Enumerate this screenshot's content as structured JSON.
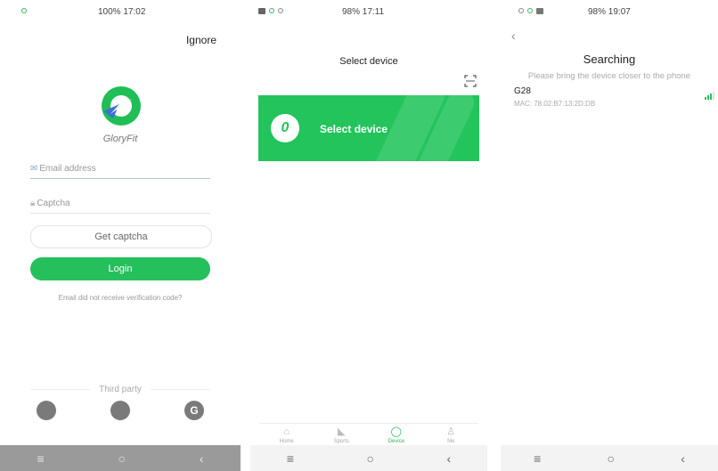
{
  "login_screen": {
    "status": {
      "time_text": "100% 17:02"
    },
    "ignore_label": "Ignore",
    "brand_name": "GloryFit",
    "email_placeholder": "Email address",
    "captcha_placeholder": "Captcha",
    "get_captcha_label": "Get captcha",
    "login_label": "Login",
    "hint_text": "Email did not receive verification code?",
    "third_party_label": "Third party",
    "social_icons": [
      "qq-icon",
      "wechat-icon",
      "google-icon"
    ],
    "social_glyphs": [
      "",
      "",
      "G"
    ],
    "accent_color": "#25c05c"
  },
  "select_screen": {
    "status": {
      "time_text": "98% 17:11"
    },
    "title": "Select device",
    "banner_label": "Select device",
    "banner_glyph": "0",
    "tabs": [
      {
        "label": "Home",
        "icon": "home-icon",
        "active": false
      },
      {
        "label": "Sports",
        "icon": "sneaker-icon",
        "active": false
      },
      {
        "label": "Device",
        "icon": "band-icon",
        "active": true
      },
      {
        "label": "Me",
        "icon": "person-icon",
        "active": false
      }
    ]
  },
  "search_screen": {
    "status": {
      "time_text": "98% 19:07"
    },
    "title": "Searching",
    "subtitle": "Please bring the device closer to the phone",
    "devices": [
      {
        "name": "G28",
        "mac": "MAC: 78:02:B7:13:2D:DB",
        "signal_level": 3
      }
    ]
  }
}
